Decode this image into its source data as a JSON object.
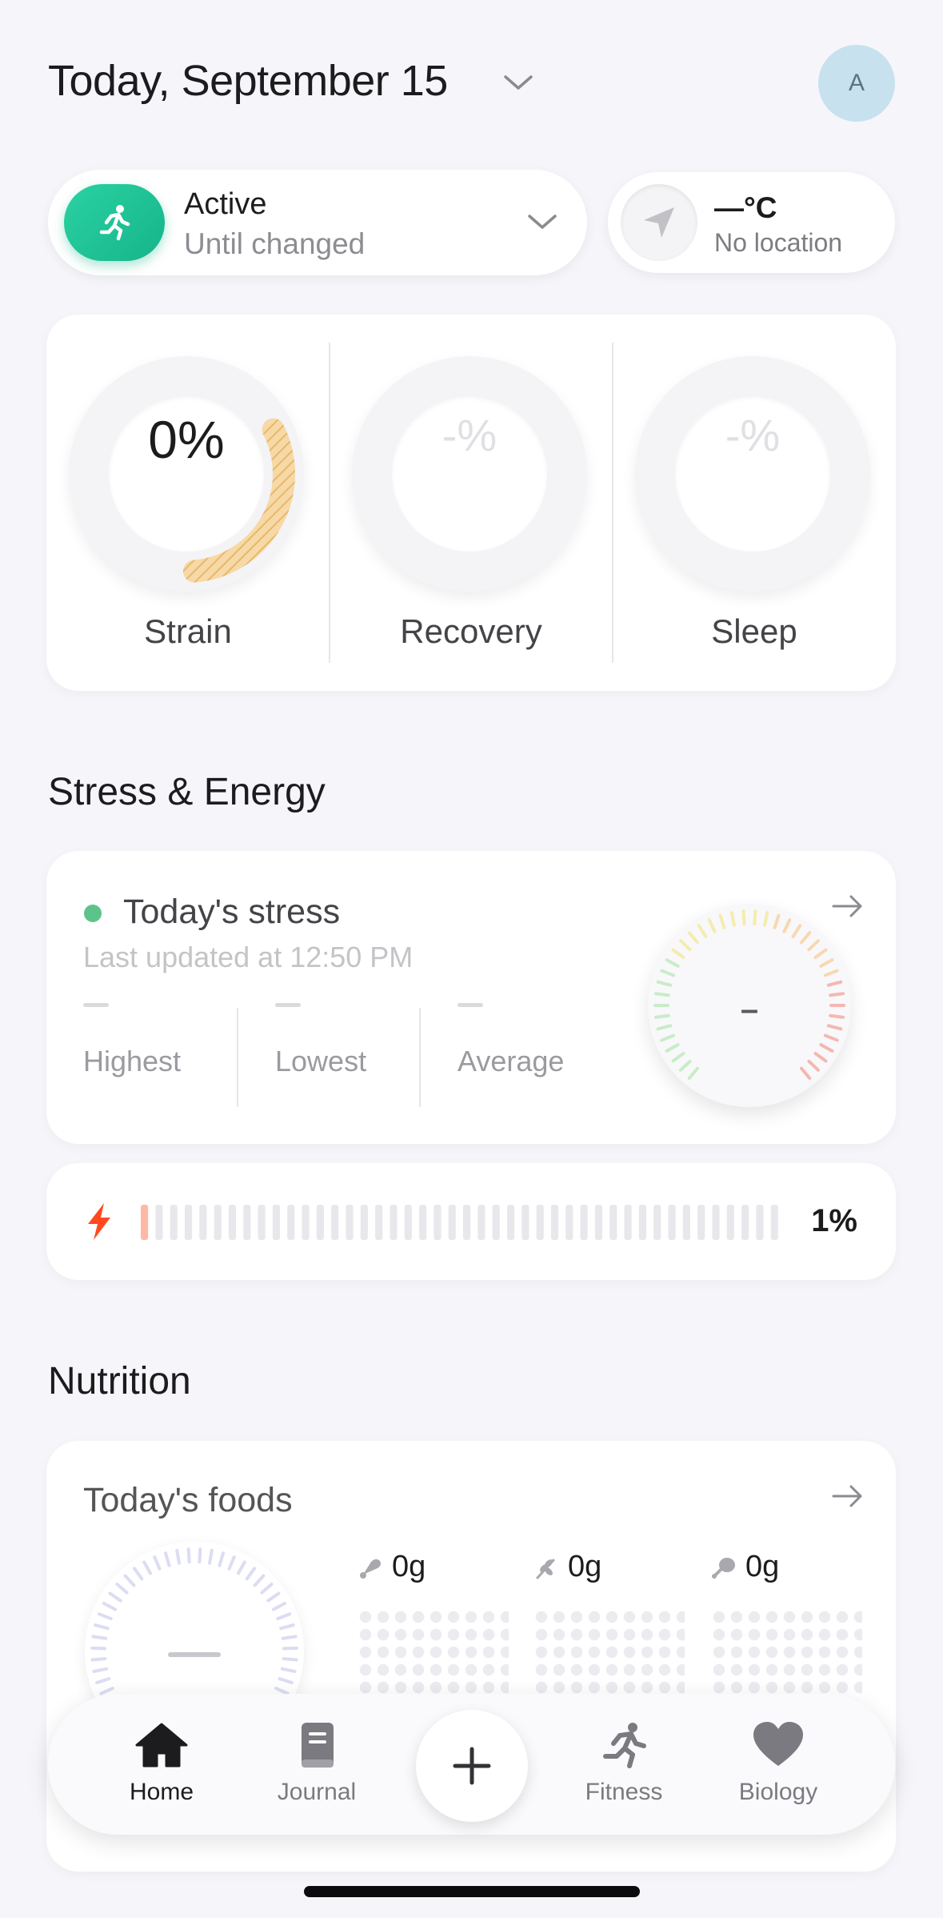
{
  "header": {
    "title": "Today, September 15",
    "avatar_initial": "A"
  },
  "activity": {
    "title": "Active",
    "subtitle": "Until changed",
    "color": "#1fc496"
  },
  "weather": {
    "temperature": "—°C",
    "location": "No location"
  },
  "scores": [
    {
      "label": "Strain",
      "value": "0%",
      "progress": 0.12,
      "color": "#f2c98a"
    },
    {
      "label": "Recovery",
      "value": "-%"
    },
    {
      "label": "Sleep",
      "value": "-%"
    }
  ],
  "stress_energy": {
    "section_title": "Stress & Energy",
    "stress": {
      "title": "Today's stress",
      "updated": "Last updated at 12:50 PM",
      "gauge_value": "–",
      "stats": [
        {
          "label": "Highest"
        },
        {
          "label": "Lowest"
        },
        {
          "label": "Average"
        }
      ]
    },
    "energy": {
      "percent_label": "1%",
      "level": 0.01,
      "accent": "#ff4a1f"
    }
  },
  "nutrition": {
    "section_title": "Nutrition",
    "foods_title": "Today's foods",
    "macros": [
      {
        "value": "0g",
        "icon": "protein-icon"
      },
      {
        "value": "0g",
        "icon": "carbs-icon"
      },
      {
        "value": "0g",
        "icon": "fat-icon"
      }
    ]
  },
  "tabbar": {
    "tabs": [
      {
        "label": "Home",
        "icon": "home-icon",
        "active": true
      },
      {
        "label": "Journal",
        "icon": "journal-icon",
        "active": false
      },
      {
        "label": "Fitness",
        "icon": "fitness-icon",
        "active": false
      },
      {
        "label": "Biology",
        "icon": "biology-icon",
        "active": false
      }
    ],
    "add_icon": "plus-icon"
  }
}
